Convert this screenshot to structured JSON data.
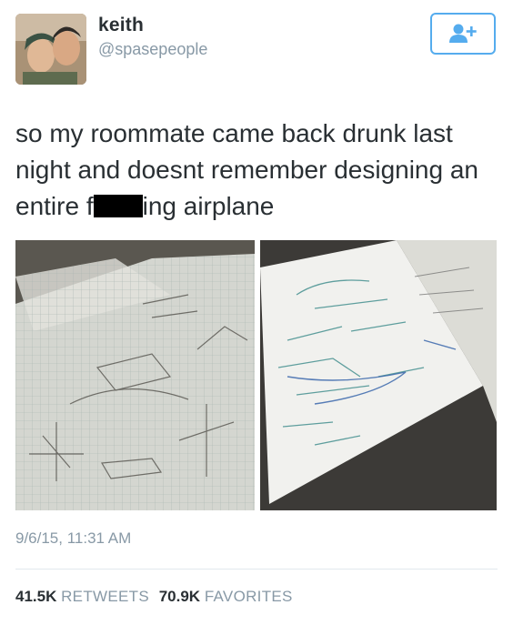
{
  "user": {
    "display_name": "keith",
    "username": "@spasepeople"
  },
  "follow_button": {
    "icon": "add-user-icon",
    "color": "#55acee"
  },
  "tweet": {
    "text_before_censor": "so my roommate came back drunk last night and doesnt remember designing an entire f",
    "text_after_censor": "ing airplane",
    "media": [
      {
        "description_icon": "photo-sketches-on-graph-paper"
      },
      {
        "description_icon": "photo-equations-on-whiteboard"
      }
    ],
    "timestamp": "9/6/15, 11:31 AM"
  },
  "stats": {
    "retweets_count": "41.5K",
    "retweets_label": "RETWEETS",
    "favorites_count": "70.9K",
    "favorites_label": "FAVORITES"
  },
  "colors": {
    "text": "#292f33",
    "muted": "#8899a6",
    "accent": "#55acee",
    "divider": "#e1e8ed"
  }
}
